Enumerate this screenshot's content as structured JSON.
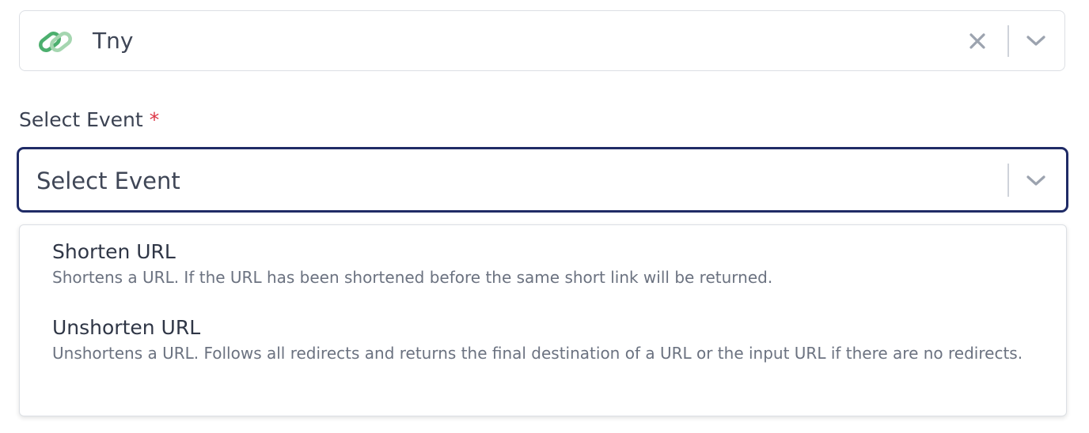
{
  "app_select": {
    "value": "Tny",
    "icon": "link-icon",
    "clear_icon": "close-icon",
    "toggle_icon": "chevron-down-icon",
    "icon_colors": [
      "#4caf6e",
      "#a5d6b0"
    ]
  },
  "event_field": {
    "label": "Select Event",
    "required_marker": "*",
    "placeholder": "Select Event",
    "toggle_icon": "chevron-down-icon",
    "focus_border_color": "#1f2b66"
  },
  "dropdown": {
    "options": [
      {
        "title": "Shorten URL",
        "description": "Shortens a URL. If the URL has been shortened before the same short link will be returned."
      },
      {
        "title": "Unshorten URL",
        "description": "Unshortens a URL. Follows all redirects and returns the final destination of a URL or the input URL if there are no redirects."
      }
    ]
  }
}
